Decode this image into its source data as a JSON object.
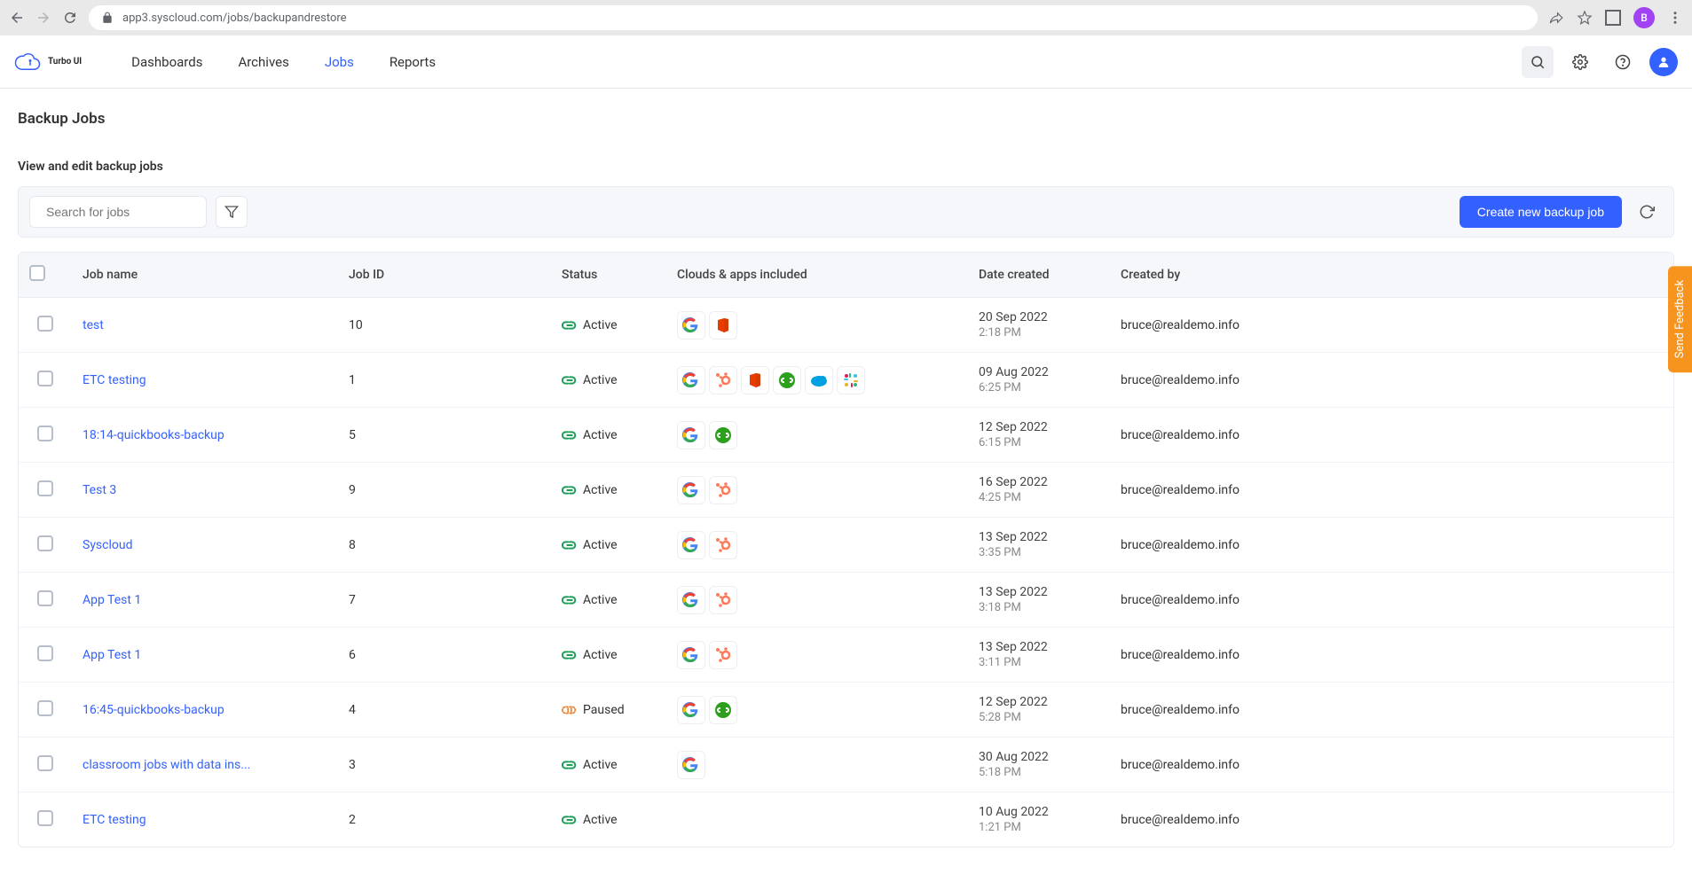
{
  "browser": {
    "url": "app3.syscloud.com/jobs/backupandrestore",
    "avatar_letter": "B"
  },
  "nav": {
    "logo_label": "Turbo UI",
    "links": [
      "Dashboards",
      "Archives",
      "Jobs",
      "Reports"
    ],
    "active_index": 2
  },
  "page": {
    "title": "Backup Jobs",
    "subtitle": "View and edit backup jobs"
  },
  "toolbar": {
    "search_placeholder": "Search for jobs",
    "create_label": "Create new backup job"
  },
  "columns": [
    "Job name",
    "Job ID",
    "Status",
    "Clouds & apps included",
    "Date created",
    "Created by"
  ],
  "rows": [
    {
      "name": "test",
      "id": "10",
      "status": "Active",
      "apps": [
        "google",
        "office"
      ],
      "date": "20 Sep 2022",
      "time": "2:18 PM",
      "by": "bruce@realdemo.info"
    },
    {
      "name": "ETC testing",
      "id": "1",
      "status": "Active",
      "apps": [
        "google",
        "hubspot",
        "office",
        "quickbooks",
        "salesforce",
        "slack"
      ],
      "date": "09 Aug 2022",
      "time": "6:25 PM",
      "by": "bruce@realdemo.info"
    },
    {
      "name": "18:14-quickbooks-backup",
      "id": "5",
      "status": "Active",
      "apps": [
        "google",
        "quickbooks"
      ],
      "date": "12 Sep 2022",
      "time": "6:15 PM",
      "by": "bruce@realdemo.info"
    },
    {
      "name": "Test 3",
      "id": "9",
      "status": "Active",
      "apps": [
        "google",
        "hubspot"
      ],
      "date": "16 Sep 2022",
      "time": "4:25 PM",
      "by": "bruce@realdemo.info"
    },
    {
      "name": "Syscloud",
      "id": "8",
      "status": "Active",
      "apps": [
        "google",
        "hubspot"
      ],
      "date": "13 Sep 2022",
      "time": "3:35 PM",
      "by": "bruce@realdemo.info"
    },
    {
      "name": "App Test 1",
      "id": "7",
      "status": "Active",
      "apps": [
        "google",
        "hubspot"
      ],
      "date": "13 Sep 2022",
      "time": "3:18 PM",
      "by": "bruce@realdemo.info"
    },
    {
      "name": "App Test 1",
      "id": "6",
      "status": "Active",
      "apps": [
        "google",
        "hubspot"
      ],
      "date": "13 Sep 2022",
      "time": "3:11 PM",
      "by": "bruce@realdemo.info"
    },
    {
      "name": "16:45-quickbooks-backup",
      "id": "4",
      "status": "Paused",
      "apps": [
        "google",
        "quickbooks"
      ],
      "date": "12 Sep 2022",
      "time": "5:28 PM",
      "by": "bruce@realdemo.info"
    },
    {
      "name": "classroom jobs with data ins...",
      "id": "3",
      "status": "Active",
      "apps": [
        "google"
      ],
      "date": "30 Aug 2022",
      "time": "5:18 PM",
      "by": "bruce@realdemo.info"
    },
    {
      "name": "ETC testing",
      "id": "2",
      "status": "Active",
      "apps": [],
      "date": "10 Aug 2022",
      "time": "1:21 PM",
      "by": "bruce@realdemo.info"
    }
  ],
  "feedback_label": "Send Feedback"
}
